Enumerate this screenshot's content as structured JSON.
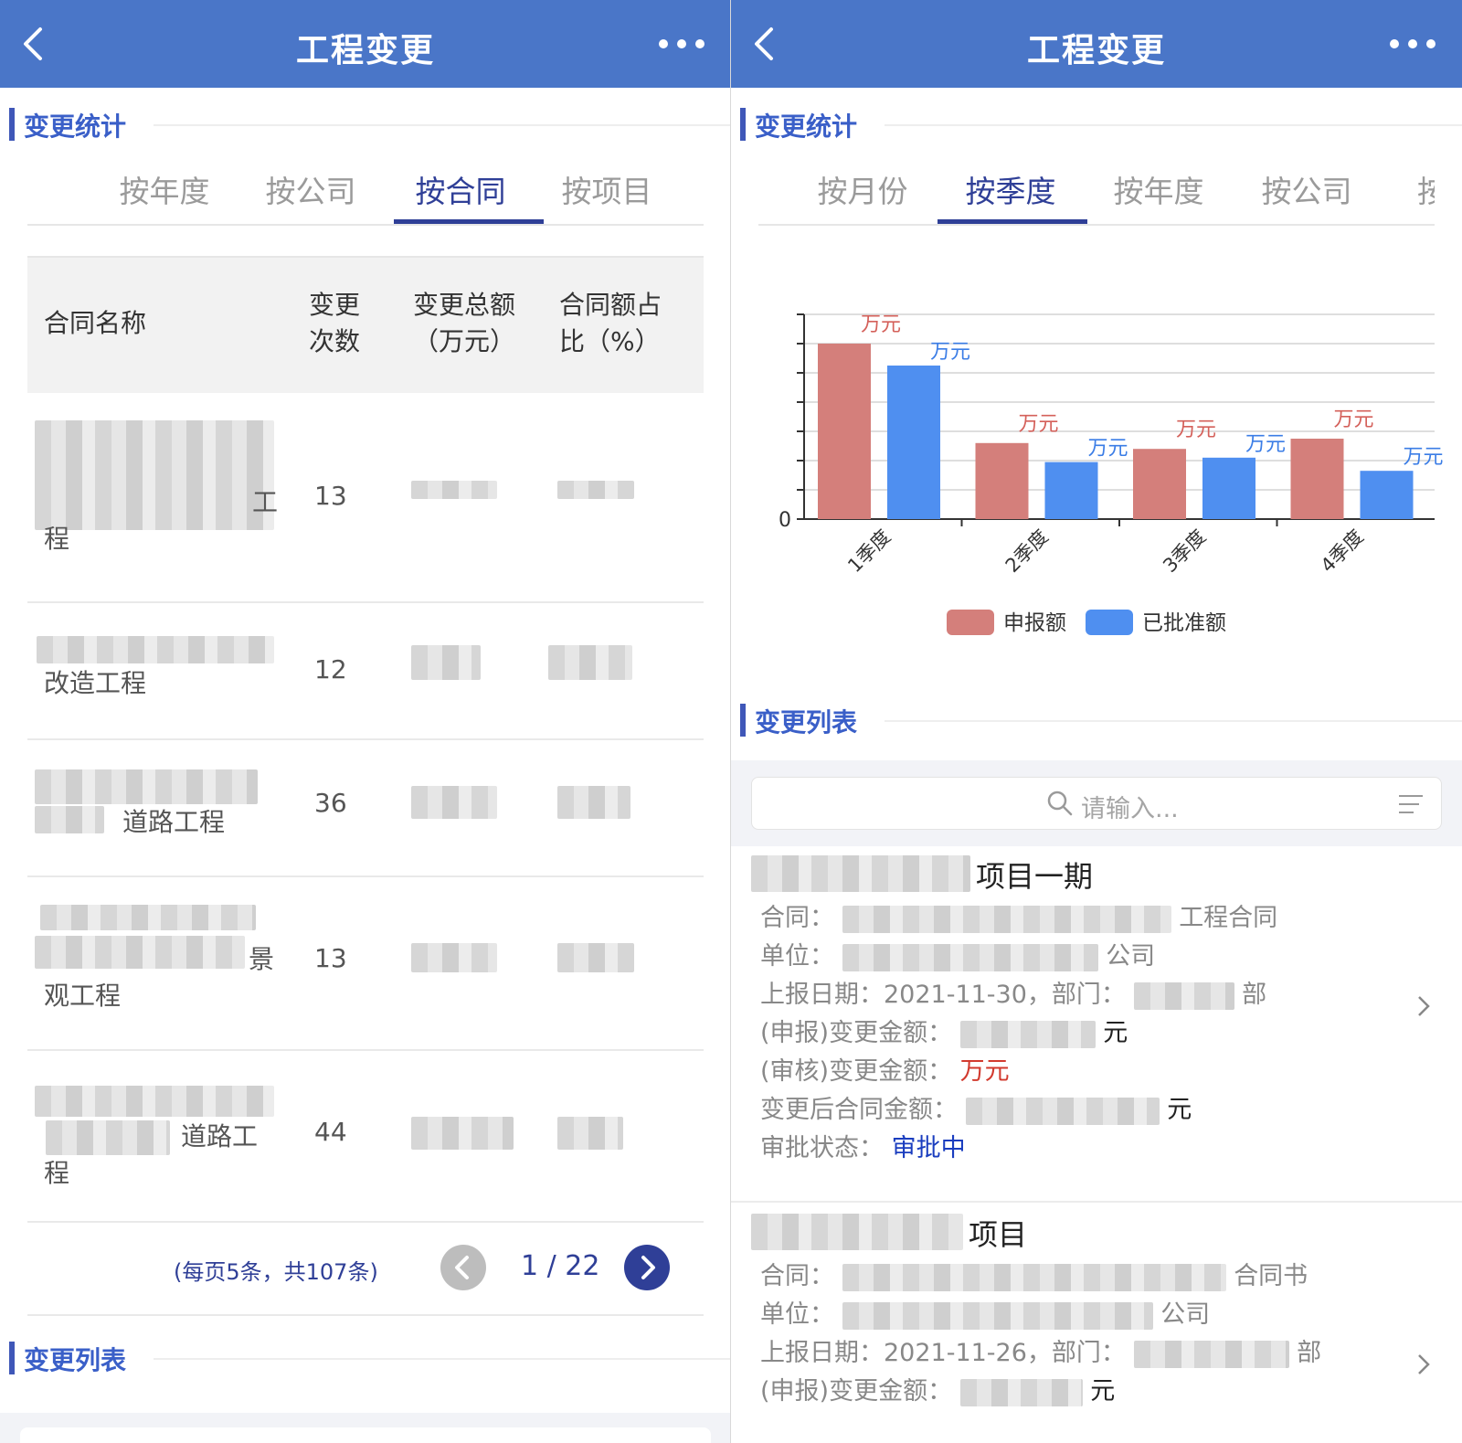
{
  "left": {
    "nav": {
      "title": "工程变更"
    },
    "section1": {
      "title": "变更统计"
    },
    "tabs": [
      "度",
      "按年度",
      "按公司",
      "按合同",
      "按项目"
    ],
    "active_tab": 3,
    "table": {
      "headers": {
        "name": "合同名称",
        "count_l1": "变更",
        "count_l2": "次数",
        "total_l1": "变更总额",
        "total_l2": "（万元）",
        "ratio_l1": "合同额占",
        "ratio_l2": "比（%）"
      },
      "rows": [
        {
          "name_suffix_1": "工",
          "name_suffix_2": "程",
          "count": "13"
        },
        {
          "name_suffix_1": "改造工程",
          "name_suffix_2": "",
          "count": "12"
        },
        {
          "name_suffix_1": "道路工程",
          "name_suffix_2": "",
          "count": "36"
        },
        {
          "name_suffix_1": "景",
          "name_suffix_2": "观工程",
          "count": "13"
        },
        {
          "name_suffix_1": "道路工",
          "name_suffix_2": "程",
          "count": "44"
        }
      ]
    },
    "pager": {
      "info": "(每页5条，共107条)",
      "page": "1 / 22"
    },
    "section2": {
      "title": "变更列表"
    }
  },
  "right": {
    "nav": {
      "title": "工程变更"
    },
    "section1": {
      "title": "变更统计"
    },
    "tabs": [
      "按月份",
      "按季度",
      "按年度",
      "按公司",
      "按合"
    ],
    "active_tab": 1,
    "chart_data": {
      "type": "bar",
      "categories": [
        "1季度",
        "2季度",
        "3季度",
        "4季度"
      ],
      "series": [
        {
          "name": "申报额",
          "color": "#d47f7b",
          "values": [
            6,
            2.6,
            2.4,
            2.75
          ]
        },
        {
          "name": "已批准额",
          "color": "#4f8ff0",
          "values": [
            5.25,
            1.95,
            2.1,
            1.65
          ]
        }
      ],
      "value_unit": "万元",
      "y_tick_labels": [
        "0"
      ],
      "ylim": [
        0,
        7
      ],
      "grid": true,
      "legend": "bottom-center"
    },
    "section2": {
      "title": "变更列表"
    },
    "search": {
      "placeholder": "请输入..."
    },
    "cards": [
      {
        "title_suffix": "项目一期",
        "contract_label": "合同：",
        "contract_suffix": "工程合同",
        "unit_label": "单位：",
        "unit_suffix": "公司",
        "date_line": "上报日期：2021-11-30，部门：",
        "dept_suffix": "部",
        "declared_label": "(申报)变更金额：",
        "declared_suffix": "元",
        "audited_label": "(审核)变更金额：",
        "audited_value": "万元",
        "after_label": "变更后合同金额：",
        "after_suffix": "元",
        "status_label": "审批状态：",
        "status_value": "审批中"
      },
      {
        "title_suffix": "项目",
        "contract_label": "合同：",
        "contract_suffix": "合同书",
        "unit_label": "单位：",
        "unit_suffix": "公司",
        "date_line": "上报日期：2021-11-26，部门：",
        "dept_suffix": "部",
        "declared_label": "(申报)变更金额：",
        "declared_suffix": "元"
      }
    ]
  }
}
